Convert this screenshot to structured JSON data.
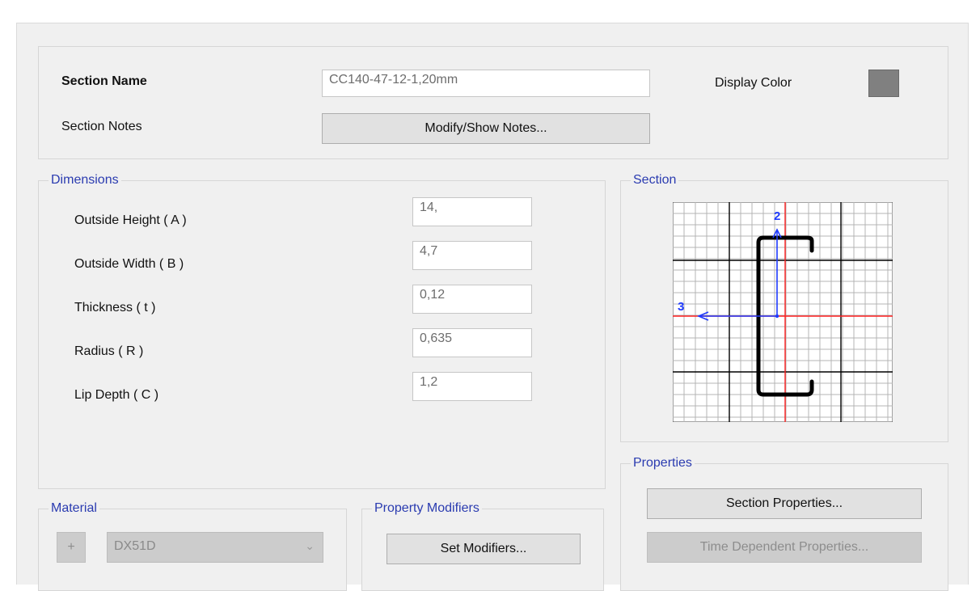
{
  "header": {
    "section_name_label": "Section Name",
    "section_name_value": "CC140-47-12-1,20mm",
    "display_color_label": "Display Color",
    "display_color": "#808080",
    "section_notes_label": "Section Notes",
    "notes_button": "Modify/Show Notes..."
  },
  "dimensions": {
    "title": "Dimensions",
    "fields": [
      {
        "label": "Outside Height  ( A )",
        "value": "14,"
      },
      {
        "label": "Outside Width  ( B )",
        "value": "4,7"
      },
      {
        "label": "Thickness  ( t )",
        "value": "0,12"
      },
      {
        "label": "Radius  ( R )",
        "value": "0,635"
      },
      {
        "label": "Lip Depth  ( C )",
        "value": "1,2"
      }
    ]
  },
  "section_preview": {
    "title": "Section",
    "axis_2_label": "2",
    "axis_3_label": "3",
    "axis_color": "#1f3bff",
    "centerline_color": "#ff2020",
    "shape_color": "#000000"
  },
  "properties": {
    "title": "Properties",
    "section_properties_button": "Section Properties...",
    "time_dependent_button": "Time Dependent Properties..."
  },
  "material": {
    "title": "Material",
    "add_button": "+",
    "selected": "DX51D"
  },
  "property_modifiers": {
    "title": "Property Modifiers",
    "set_button": "Set Modifiers..."
  }
}
